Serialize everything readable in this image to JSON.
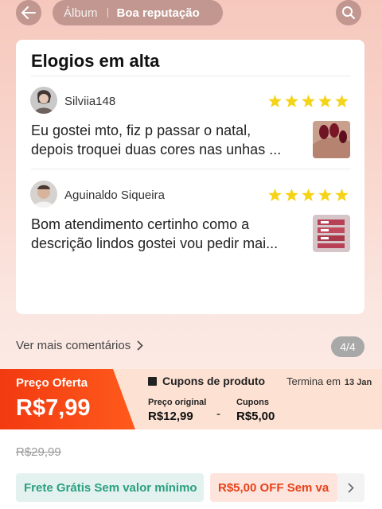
{
  "header": {
    "tabs": [
      "Álbum",
      "Boa reputação"
    ],
    "active_tab": "Boa reputação"
  },
  "section": {
    "title": "Elogios em alta",
    "rating_color": "#f5d317",
    "reviews": [
      {
        "username": "Silviia148",
        "stars": 5,
        "text_line1": "Eu gostei mto, fiz p passar o natal,",
        "text_line2": "depois troquei duas cores nas unhas ..."
      },
      {
        "username": "Aguinaldo Siqueira",
        "stars": 5,
        "text_line1": "Bom atendimento certinho como a",
        "text_line2": "descrição lindos gostei vou pedir mai..."
      }
    ]
  },
  "more_comments": {
    "label": "Ver mais comentários",
    "pager": "4/4"
  },
  "price": {
    "offer_label": "Preço Oferta",
    "offer_price": "R$7,99",
    "coupons_title": "Cupons de produto",
    "ends_label": "Termina em",
    "ends_date": "13 Jan",
    "original_label": "Preço original",
    "original_value": "R$12,99",
    "minus": "-",
    "coupons_label": "Cupons",
    "coupons_value": "R$5,00",
    "accent": "#f2451a"
  },
  "bottom": {
    "old_price": "R$29,99",
    "free_shipping": "Frete Grátis Sem valor mínimo",
    "discount": "R$5,00 OFF Sem va"
  }
}
